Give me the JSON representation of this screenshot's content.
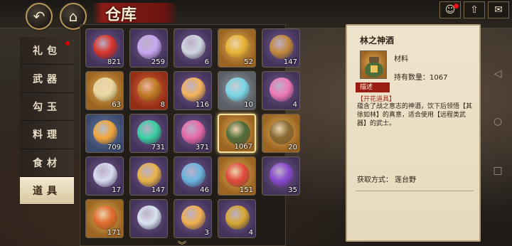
{
  "header": {
    "title": "仓库",
    "back_icon": "back-arrow-icon",
    "home_icon": "house-icon"
  },
  "topright": [
    {
      "icon": "character-icon",
      "glyph": "☺",
      "badge": true
    },
    {
      "icon": "level-up-icon",
      "glyph": "⇧",
      "badge": false
    },
    {
      "icon": "mail-icon",
      "glyph": "✉",
      "badge": false
    }
  ],
  "sidebar": {
    "items": [
      {
        "label": "礼包",
        "badge": true,
        "active": false
      },
      {
        "label": "武器",
        "badge": false,
        "active": false
      },
      {
        "label": "勾玉",
        "badge": false,
        "active": false
      },
      {
        "label": "料理",
        "badge": false,
        "active": false
      },
      {
        "label": "食材",
        "badge": false,
        "active": false
      },
      {
        "label": "道具",
        "badge": false,
        "active": true
      }
    ]
  },
  "inventory": {
    "items": [
      {
        "count": "821",
        "rarity": "purple",
        "icon": "red-orb-icon",
        "color": "#d8352a"
      },
      {
        "count": "259",
        "rarity": "purple",
        "icon": "rainbow-orb-icon",
        "color": "#c9a8f0"
      },
      {
        "count": "6",
        "rarity": "purple",
        "icon": "bell-icon",
        "color": "#d0d6e0"
      },
      {
        "count": "52",
        "rarity": "gold",
        "icon": "gold-charm-icon",
        "color": "#e8b236"
      },
      {
        "count": "147",
        "rarity": "purple",
        "icon": "scroll-charm-icon",
        "color": "#c28a3a"
      },
      {
        "count": "63",
        "rarity": "gold",
        "icon": "talisman-icon",
        "color": "#e9d8a0"
      },
      {
        "count": "8",
        "rarity": "red",
        "icon": "charm-icon",
        "color": "#c07a24"
      },
      {
        "count": "116",
        "rarity": "purple",
        "icon": "orange-flame-icon",
        "color": "#f4b45a"
      },
      {
        "count": "10",
        "rarity": "grey",
        "icon": "blue-flame-icon",
        "color": "#7ad8e8"
      },
      {
        "count": "4",
        "rarity": "purple",
        "icon": "pink-flame-icon",
        "color": "#f07ab8"
      },
      {
        "count": "709",
        "rarity": "blue",
        "icon": "golden-flame-icon",
        "color": "#f3a63a"
      },
      {
        "count": "731",
        "rarity": "purple",
        "icon": "green-flame-icon",
        "color": "#3ad0a2"
      },
      {
        "count": "371",
        "rarity": "purple",
        "icon": "pink-flame-icon",
        "color": "#e86aa8"
      },
      {
        "count": "1067",
        "rarity": "gold",
        "icon": "wine-jar-icon",
        "color": "#4e6b3a",
        "selected": true
      },
      {
        "count": "20",
        "rarity": "gold",
        "icon": "wine-jar-icon",
        "color": "#8a6a34"
      },
      {
        "count": "17",
        "rarity": "purple",
        "icon": "white-crystal-icon",
        "color": "#d8dcf0"
      },
      {
        "count": "147",
        "rarity": "purple",
        "icon": "gold-crystal-icon",
        "color": "#e8b44a"
      },
      {
        "count": "46",
        "rarity": "purple",
        "icon": "blue-crystal-icon",
        "color": "#6ab6e0"
      },
      {
        "count": "151",
        "rarity": "gold",
        "icon": "red-crystal-icon",
        "color": "#e0483c"
      },
      {
        "count": "35",
        "rarity": "purple",
        "icon": "purple-orb-icon",
        "color": "#8a4ad0"
      },
      {
        "count": "171",
        "rarity": "gold",
        "icon": "prayer-beads-icon",
        "color": "#e06a2a"
      },
      {
        "count": "",
        "rarity": "purple",
        "icon": "water-drop-icon",
        "color": "#d8e4f0"
      },
      {
        "count": "3",
        "rarity": "purple",
        "icon": "amber-drop-icon",
        "color": "#f0b050"
      },
      {
        "count": "4",
        "rarity": "purple",
        "icon": "gold-box-icon",
        "color": "#d8a830"
      }
    ]
  },
  "detail": {
    "name": "林之神酒",
    "type": "材料",
    "own_label": "持有数量：",
    "own_count": "1067",
    "tag": "描述",
    "subtitle": "【开花道具】",
    "description": "蕴含了战之意志的神酒，饮下后领悟【其徐如林】的真意，适合使用【远程类武器】的武士。",
    "source": "获取方式：  莲台野"
  }
}
